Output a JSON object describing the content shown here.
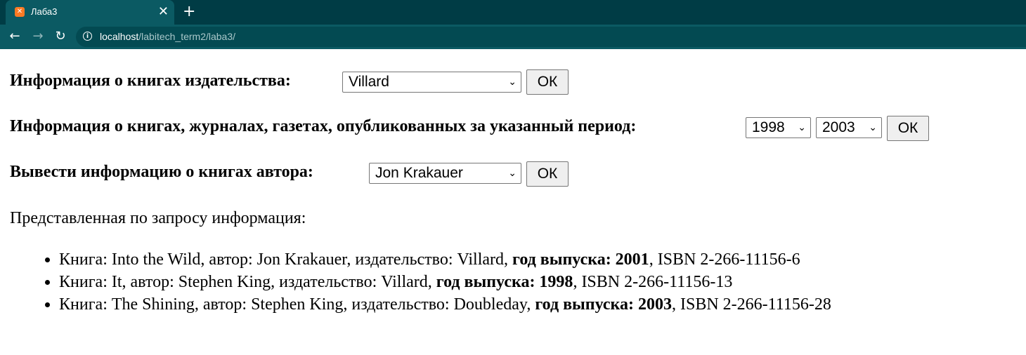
{
  "browser": {
    "tab_title": "Лаба3",
    "favicon": "xampp-icon",
    "close_glyph": "✕",
    "new_tab_glyph": "+",
    "back_glyph": "←",
    "forward_glyph": "→",
    "reload_glyph": "↻",
    "url_host": "localhost",
    "url_path": "/labitech_term2/laba3/",
    "accent_color": "#003c45"
  },
  "forms": {
    "publisher": {
      "label": "Информация о книгах издательства:",
      "selected": "Villard",
      "button": "ОК"
    },
    "period": {
      "label": "Информация о книгах, журналах, газетах, опубликованных за указанный период:",
      "from_year": "1998",
      "to_year": "2003",
      "button": "ОК"
    },
    "author": {
      "label": "Вывести информацию о книгах автора:",
      "selected": "Jon Krakauer",
      "button": "ОК"
    }
  },
  "results": {
    "heading": "Представленная по запросу информация:",
    "items": [
      {
        "prefix": "Книга: Into the Wild, автор: Jon Krakauer, издательство: Villard, ",
        "year_label": "год выпуска: 2001",
        "suffix": ", ISBN 2-266-11156-6"
      },
      {
        "prefix": "Книга: It, автор: Stephen King, издательство: Villard, ",
        "year_label": "год выпуска: 1998",
        "suffix": ", ISBN 2-266-11156-13"
      },
      {
        "prefix": "Книга: The Shining, автор: Stephen King, издательство: Doubleday, ",
        "year_label": "год выпуска: 2003",
        "suffix": ", ISBN 2-266-11156-28"
      }
    ]
  }
}
